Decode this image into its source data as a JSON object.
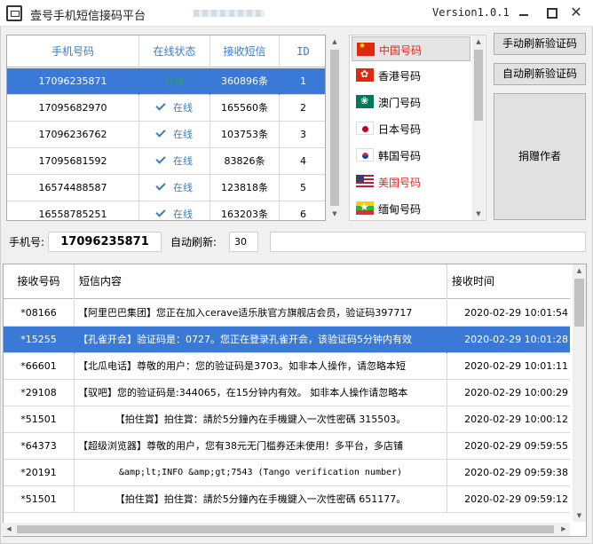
{
  "window": {
    "title": "壹号手机短信接码平台",
    "version": "Version1.0.1",
    "minimize_glyph": "_",
    "close_glyph": "✕"
  },
  "phone_table": {
    "headers": [
      "手机号码",
      "在线状态",
      "接收短信",
      "ID"
    ],
    "rows": [
      {
        "phone": "17096235871",
        "status": "在线",
        "count": "360896条",
        "id": "1"
      },
      {
        "phone": "17095682970",
        "status": "在线",
        "count": "165560条",
        "id": "2"
      },
      {
        "phone": "17096236762",
        "status": "在线",
        "count": "103753条",
        "id": "3"
      },
      {
        "phone": "17095681592",
        "status": "在线",
        "count": "83826条",
        "id": "4"
      },
      {
        "phone": "16574488587",
        "status": "在线",
        "count": "123818条",
        "id": "5"
      },
      {
        "phone": "16558785251",
        "status": "在线",
        "count": "163203条",
        "id": "6"
      }
    ]
  },
  "countries": [
    {
      "label": "中国号码",
      "flag": "cn-flag-icon",
      "highlight": true
    },
    {
      "label": "香港号码",
      "flag": "hk-flag-icon",
      "highlight": false
    },
    {
      "label": "澳门号码",
      "flag": "mo-flag-icon",
      "highlight": false
    },
    {
      "label": "日本号码",
      "flag": "jp-flag-icon",
      "highlight": false
    },
    {
      "label": "韩国号码",
      "flag": "kr-flag-icon",
      "highlight": false
    },
    {
      "label": "美国号码",
      "flag": "us-flag-icon",
      "highlight": true
    },
    {
      "label": "缅甸号码",
      "flag": "mm-flag-icon",
      "highlight": false
    }
  ],
  "buttons": {
    "manual_refresh": "手动刷新验证码",
    "auto_refresh": "自动刷新验证码",
    "donate": "捐赠作者"
  },
  "phone_bar": {
    "phone_label": "手机号:",
    "phone_value": "17096235871",
    "auto_label": "自动刷新:",
    "auto_value": "30"
  },
  "sms_table": {
    "headers": [
      "接收号码",
      "短信内容",
      "接收时间"
    ],
    "rows": [
      {
        "from": "*08166",
        "content": "【阿里巴巴集团】您正在加入cerave适乐肤官方旗舰店会员，验证码397717",
        "time": "2020-02-29 10:01:54"
      },
      {
        "from": "*15255",
        "content": "【孔雀开会】验证码是：0727。您正在登录孔雀开会，该验证码5分钟内有效",
        "time": "2020-02-29 10:01:28"
      },
      {
        "from": "*66601",
        "content": "【北瓜电话】尊敬的用户：您的验证码是3703。如非本人操作，请忽略本短",
        "time": "2020-02-29 10:01:11"
      },
      {
        "from": "*29108",
        "content": "【驭吧】您的验证码是:344065，在15分钟内有效。  如非本人操作请忽略本",
        "time": "2020-02-29 10:00:29"
      },
      {
        "from": "*51501",
        "content": "【拍住賞】拍住賞：請於5分鐘內在手機鍵入一次性密碼  315503。",
        "time": "2020-02-29 10:00:12"
      },
      {
        "from": "*64373",
        "content": "【超级浏览器】尊敬的用户，您有38元无门槛券还未使用！多平台，多店铺",
        "time": "2020-02-29 09:59:55"
      },
      {
        "from": "*20191",
        "content": "&amp;lt;INFO  &amp;gt;7543  (Tango  verification  number)",
        "time": "2020-02-29 09:59:38"
      },
      {
        "from": "*51501",
        "content": "【拍住賞】拍住賞：請於5分鐘內在手機鍵入一次性密碼  651177。",
        "time": "2020-02-29 09:59:12"
      }
    ]
  },
  "colors": {
    "selection": "#3a79d6",
    "header_text": "#3a7dc1",
    "highlight_red": "#e8261b"
  }
}
